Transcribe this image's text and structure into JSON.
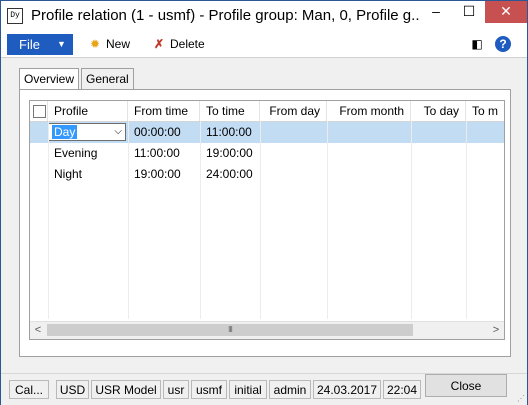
{
  "window": {
    "title": "Profile relation (1 - usmf) - Profile group: Man, 0, Profile g...",
    "icon_text": "Dy",
    "controls": {
      "minimize": "–",
      "maximize": "☐",
      "close": "✕"
    }
  },
  "toolbar": {
    "file_label": "File",
    "new_label": "New",
    "delete_label": "Delete"
  },
  "tabs": [
    {
      "label": "Overview",
      "active": true
    },
    {
      "label": "General",
      "active": false
    }
  ],
  "grid": {
    "columns": [
      "Profile",
      "From time",
      "To time",
      "From day",
      "From month",
      "To day",
      "To m"
    ],
    "rows": [
      {
        "profile": "Day",
        "from_time": "00:00:00",
        "to_time": "11:00:00",
        "selected": true
      },
      {
        "profile": "Evening",
        "from_time": "11:00:00",
        "to_time": "19:00:00",
        "selected": false
      },
      {
        "profile": "Night",
        "from_time": "19:00:00",
        "to_time": "24:00:00",
        "selected": false
      }
    ],
    "scroll_left": "<",
    "scroll_right": ">",
    "thumb_grip": "III"
  },
  "status_bar": {
    "items": [
      "Cal...",
      "USD",
      "USR Model",
      "usr",
      "usmf",
      "initial",
      "admin",
      "24.03.2017",
      "22:04"
    ],
    "close_label": "Close"
  },
  "colors": {
    "accent": "#1e5cc0",
    "selection": "#c2dcf4",
    "close_red": "#c75050"
  }
}
